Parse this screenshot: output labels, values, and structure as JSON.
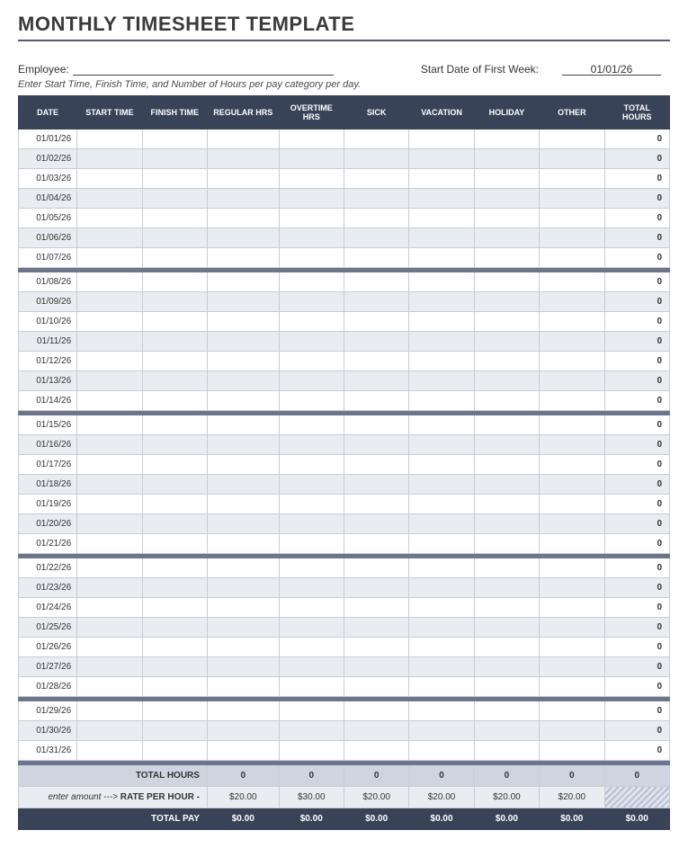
{
  "title": "MONTHLY TIMESHEET TEMPLATE",
  "header": {
    "employee_label": "Employee:",
    "employee_value": "",
    "start_label": "Start Date of First Week:",
    "start_value": "01/01/26",
    "instructions": "Enter Start Time, Finish Time, and Number of Hours per pay category per day."
  },
  "columns": [
    "DATE",
    "START TIME",
    "FINISH TIME",
    "REGULAR HRS",
    "OVERTIME HRS",
    "SICK",
    "VACATION",
    "HOLIDAY",
    "OTHER",
    "TOTAL HOURS"
  ],
  "weeks": [
    [
      {
        "date": "01/01/26",
        "total": "0"
      },
      {
        "date": "01/02/26",
        "total": "0"
      },
      {
        "date": "01/03/26",
        "total": "0"
      },
      {
        "date": "01/04/26",
        "total": "0"
      },
      {
        "date": "01/05/26",
        "total": "0"
      },
      {
        "date": "01/06/26",
        "total": "0"
      },
      {
        "date": "01/07/26",
        "total": "0"
      }
    ],
    [
      {
        "date": "01/08/26",
        "total": "0"
      },
      {
        "date": "01/09/26",
        "total": "0"
      },
      {
        "date": "01/10/26",
        "total": "0"
      },
      {
        "date": "01/11/26",
        "total": "0"
      },
      {
        "date": "01/12/26",
        "total": "0"
      },
      {
        "date": "01/13/26",
        "total": "0"
      },
      {
        "date": "01/14/26",
        "total": "0"
      }
    ],
    [
      {
        "date": "01/15/26",
        "total": "0"
      },
      {
        "date": "01/16/26",
        "total": "0"
      },
      {
        "date": "01/17/26",
        "total": "0"
      },
      {
        "date": "01/18/26",
        "total": "0"
      },
      {
        "date": "01/19/26",
        "total": "0"
      },
      {
        "date": "01/20/26",
        "total": "0"
      },
      {
        "date": "01/21/26",
        "total": "0"
      }
    ],
    [
      {
        "date": "01/22/26",
        "total": "0"
      },
      {
        "date": "01/23/26",
        "total": "0"
      },
      {
        "date": "01/24/26",
        "total": "0"
      },
      {
        "date": "01/25/26",
        "total": "0"
      },
      {
        "date": "01/26/26",
        "total": "0"
      },
      {
        "date": "01/27/26",
        "total": "0"
      },
      {
        "date": "01/28/26",
        "total": "0"
      }
    ],
    [
      {
        "date": "01/29/26",
        "total": "0"
      },
      {
        "date": "01/30/26",
        "total": "0"
      },
      {
        "date": "01/31/26",
        "total": "0"
      }
    ]
  ],
  "footer": {
    "total_hours_label": "TOTAL HOURS",
    "total_hours": [
      "0",
      "0",
      "0",
      "0",
      "0",
      "0",
      "0"
    ],
    "rate_label_prefix": "enter amount ---> ",
    "rate_label_bold": "RATE PER HOUR -",
    "rates": [
      "$20.00",
      "$30.00",
      "$20.00",
      "$20.00",
      "$20.00",
      "$20.00"
    ],
    "total_pay_label": "TOTAL PAY",
    "total_pay": [
      "$0.00",
      "$0.00",
      "$0.00",
      "$0.00",
      "$0.00",
      "$0.00",
      "$0.00"
    ]
  }
}
